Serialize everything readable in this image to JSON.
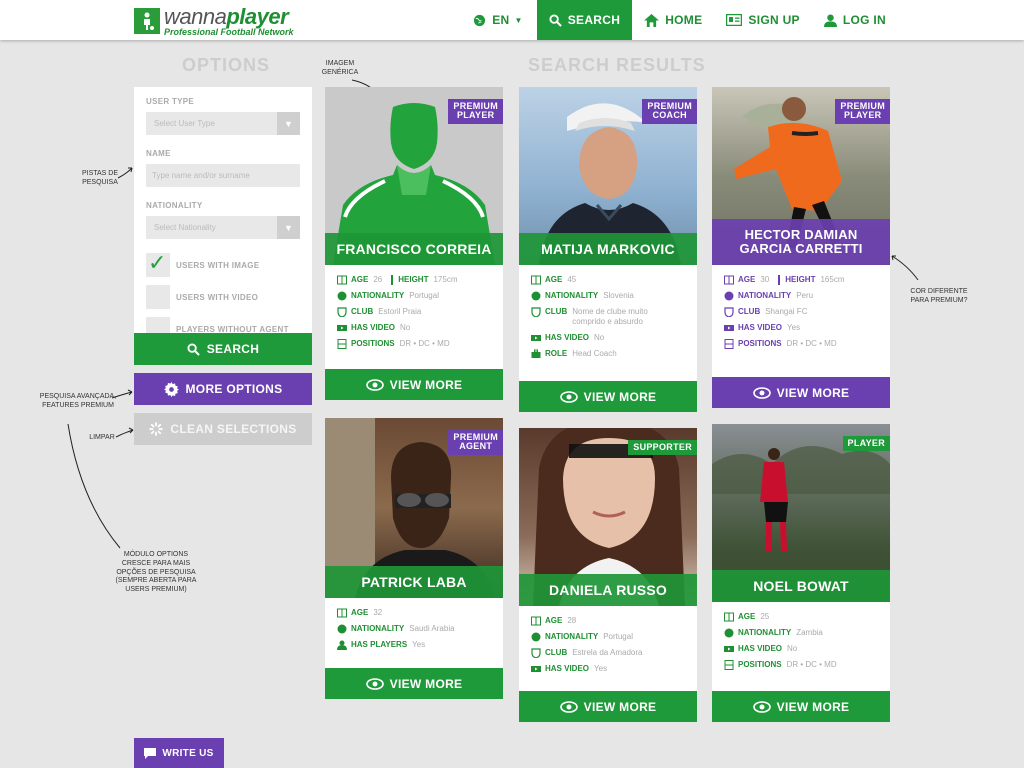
{
  "brand": {
    "word_light": "wanna",
    "word_bold": "player",
    "tagline": "Professional Football Network"
  },
  "nav": {
    "language": "EN",
    "search": "SEARCH",
    "home": "HOME",
    "signup": "SIGN UP",
    "login": "LOG IN"
  },
  "titles": {
    "options": "OPTIONS",
    "results": "SEARCH RESULTS"
  },
  "options": {
    "user_type_label": "USER TYPE",
    "user_type_placeholder": "Select User Type",
    "name_label": "NAME",
    "name_placeholder": "Type name and/or surname",
    "nationality_label": "NATIONALITY",
    "nationality_placeholder": "Select Nationality",
    "checks": [
      {
        "label": "USERS WITH IMAGE",
        "checked": true
      },
      {
        "label": "USERS WITH VIDEO",
        "checked": false
      },
      {
        "label": "PLAYERS WITHOUT AGENT",
        "checked": false
      }
    ],
    "search_button": "SEARCH",
    "more_button": "MORE OPTIONS",
    "clean_button": "CLEAN SELECTIONS",
    "write_button": "WRITE US"
  },
  "annotations": {
    "imagem": "IMAGEM\nGENÉRICA",
    "pistas": "PISTAS DE\nPESQUISA",
    "cor": "COR DIFERENTE\nPARA PREMIUM?",
    "avancada": "PESQUISA AVANÇADA,\nFEATURES PREMIUM",
    "limpar": "LIMPAR",
    "modulo": "MÓDULO OPTIONS\nCRESCE PARA MAIS\nOPÇÕES DE PESQUISA\n(SEMPRE ABERTA PARA\nUSERS PREMIUM)"
  },
  "cards": [
    {
      "name": "FRANCISCO CORREIA",
      "badge": "PREMIUM\nPLAYER",
      "badge_color": "purple",
      "band_color": "green",
      "age_label": "AGE",
      "age": "26",
      "height_label": "HEIGHT",
      "height": "175cm",
      "rows": [
        {
          "icon": "globe-icon",
          "k": "NATIONALITY",
          "v": "Portugal"
        },
        {
          "icon": "shield-icon",
          "k": "CLUB",
          "v": "Estoril Praia"
        },
        {
          "icon": "video-icon",
          "k": "HAS VIDEO",
          "v": "No"
        },
        {
          "icon": "pitch-icon",
          "k": "POSITIONS",
          "v": "DR • DC • MD"
        }
      ],
      "view": "VIEW MORE"
    },
    {
      "name": "MATIJA MARKOVIC",
      "badge": "PREMIUM\nCOACH",
      "badge_color": "purple",
      "band_color": "green",
      "age_label": "AGE",
      "age": "45",
      "rows": [
        {
          "icon": "globe-icon",
          "k": "NATIONALITY",
          "v": "Slovenia"
        },
        {
          "icon": "shield-icon",
          "k": "CLUB",
          "v": "Nome de clube muito comprido e absurdo"
        },
        {
          "icon": "video-icon",
          "k": "HAS VIDEO",
          "v": "No"
        },
        {
          "icon": "briefcase-icon",
          "k": "ROLE",
          "v": "Head Coach"
        }
      ],
      "view": "VIEW MORE"
    },
    {
      "name": "HECTOR DAMIAN\nGARCIA CARRETTI",
      "badge": "PREMIUM\nPLAYER",
      "badge_color": "purple",
      "band_color": "purple",
      "age_label": "AGE",
      "age": "30",
      "height_label": "HEIGHT",
      "height": "165cm",
      "rows": [
        {
          "icon": "globe-icon",
          "k": "NATIONALITY",
          "v": "Peru"
        },
        {
          "icon": "shield-icon",
          "k": "CLUB",
          "v": "Shangai FC"
        },
        {
          "icon": "video-icon",
          "k": "HAS VIDEO",
          "v": "Yes"
        },
        {
          "icon": "pitch-icon",
          "k": "POSITIONS",
          "v": "DR • DC • MD"
        }
      ],
      "view": "VIEW MORE"
    },
    {
      "name": "PATRICK LABA",
      "badge": "PREMIUM\nAGENT",
      "badge_color": "purple",
      "band_color": "green",
      "age_label": "AGE",
      "age": "32",
      "rows": [
        {
          "icon": "globe-icon",
          "k": "NATIONALITY",
          "v": "Saudi Arabia"
        },
        {
          "icon": "person-icon",
          "k": "HAS PLAYERS",
          "v": "Yes"
        }
      ],
      "view": "VIEW MORE"
    },
    {
      "name": "DANIELA RUSSO",
      "badge": "SUPPORTER",
      "badge_color": "green",
      "band_color": "green",
      "age_label": "AGE",
      "age": "28",
      "rows": [
        {
          "icon": "globe-icon",
          "k": "NATIONALITY",
          "v": "Portugal"
        },
        {
          "icon": "shield-icon",
          "k": "CLUB",
          "v": "Estrela da Amadora"
        },
        {
          "icon": "video-icon",
          "k": "HAS VIDEO",
          "v": "Yes"
        }
      ],
      "view": "VIEW MORE"
    },
    {
      "name": "NOEL BOWAT",
      "badge": "PLAYER",
      "badge_color": "green",
      "band_color": "green",
      "age_label": "AGE",
      "age": "25",
      "rows": [
        {
          "icon": "globe-icon",
          "k": "NATIONALITY",
          "v": "Zambia"
        },
        {
          "icon": "video-icon",
          "k": "HAS VIDEO",
          "v": "No"
        },
        {
          "icon": "pitch-icon",
          "k": "POSITIONS",
          "v": "DR • DC • MD"
        }
      ],
      "view": "VIEW MORE"
    }
  ],
  "colors": {
    "green": "#1f9a3a",
    "purple": "#6a3fb0",
    "grey_button": "#cdcdcd"
  }
}
